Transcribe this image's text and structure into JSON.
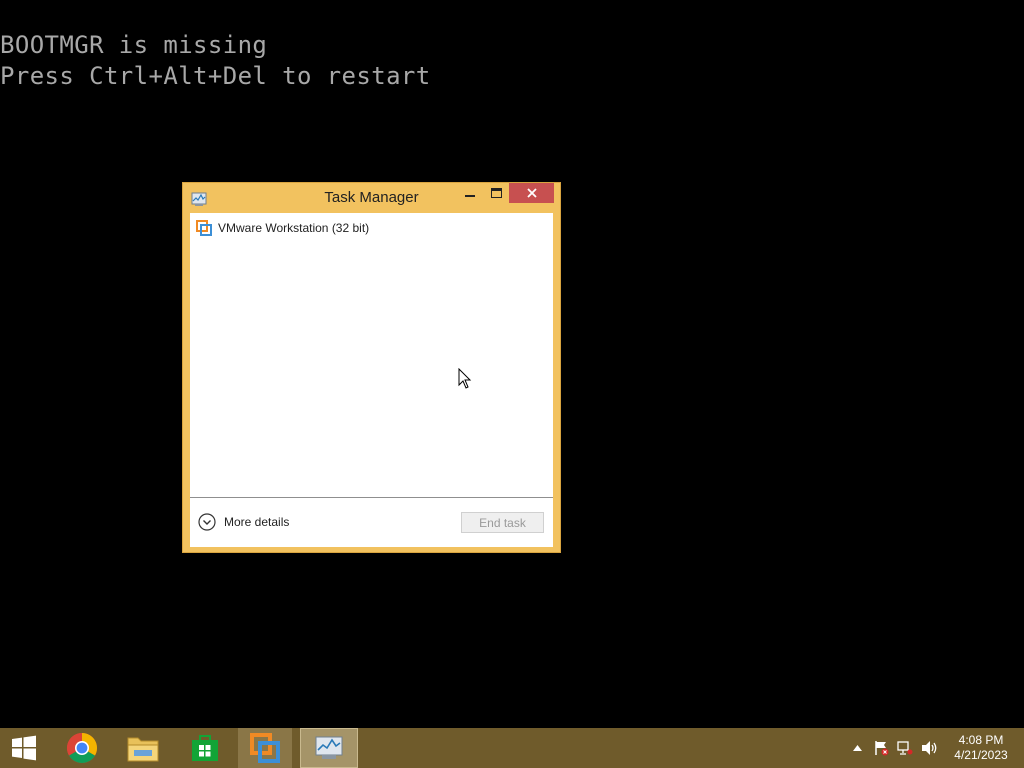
{
  "console": {
    "line1": "BOOTMGR is missing",
    "line2": "Press Ctrl+Alt+Del to restart"
  },
  "task_manager": {
    "title": "Task Manager",
    "icon": "task-manager-icon",
    "processes": [
      {
        "label": "VMware Workstation (32 bit)",
        "icon": "vmware-icon"
      }
    ],
    "more_details_label": "More details",
    "end_task_label": "End task"
  },
  "taskbar": {
    "items": [
      "windows-start",
      "chrome",
      "file-explorer",
      "store",
      "vmware",
      "task-manager"
    ],
    "clock_time": "4:08 PM",
    "clock_date": "4/21/2023"
  },
  "colors": {
    "window_frame": "#f2c25f",
    "close_button": "#c75050",
    "taskbar": "#6f5b2b",
    "console_text": "#a8a8a8"
  }
}
